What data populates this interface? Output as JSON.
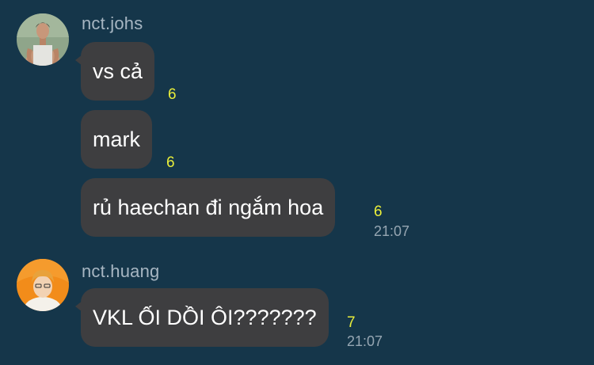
{
  "colors": {
    "background": "#15364a",
    "bubble": "#3e3e40",
    "bubble_text": "#ffffff",
    "sender_name": "#a7b6c2",
    "seen_count": "#e9ee3a",
    "timestamp": "#96a6b2"
  },
  "groups": [
    {
      "sender": "nct.johs",
      "avatar_icon": "user-avatar-man-tank-top",
      "messages": [
        {
          "text": "vs cả",
          "seen_count": "6",
          "time": ""
        },
        {
          "text": "mark",
          "seen_count": "6",
          "time": ""
        },
        {
          "text": "rủ haechan đi ngắm hoa",
          "seen_count": "6",
          "time": "21:07"
        }
      ]
    },
    {
      "sender": "nct.huang",
      "avatar_icon": "user-avatar-man-orange-hair",
      "messages": [
        {
          "text": "VKL ỐI DỒI ÔI???????",
          "seen_count": "7",
          "time": "21:07"
        }
      ]
    }
  ]
}
